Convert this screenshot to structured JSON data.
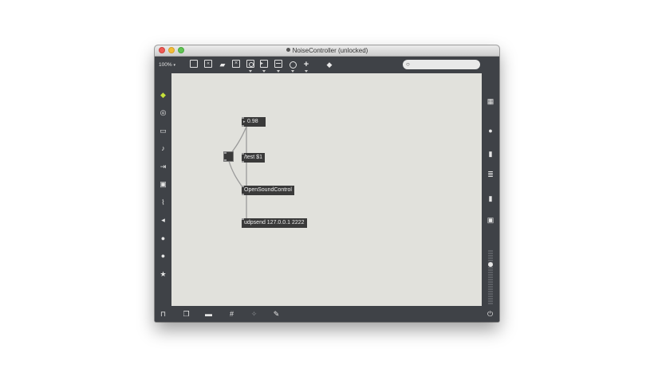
{
  "window": {
    "title": "NoiseController (unlocked)",
    "traffic_lights": [
      "close",
      "minimize",
      "zoom"
    ]
  },
  "toolbar": {
    "zoom_level": "100%",
    "zoom_arrow": "▾",
    "tools": [
      {
        "name": "presentation-view-icon"
      },
      {
        "name": "message-box-icon"
      },
      {
        "name": "comment-icon"
      },
      {
        "name": "object-box-icon"
      },
      {
        "name": "bang-icon"
      },
      {
        "name": "toggle-icon"
      },
      {
        "name": "number-box-icon"
      },
      {
        "name": "dial-icon"
      },
      {
        "name": "add-object-icon"
      },
      {
        "name": "paint-bucket-icon"
      }
    ],
    "search": {
      "placeholder": "",
      "icon": "magnifier-icon"
    }
  },
  "left_sidebar": {
    "icons": [
      "cube-icon",
      "target-icon",
      "slider-icon",
      "music-note-icon",
      "playback-icon",
      "image-icon",
      "paperclip-icon",
      "plug-icon",
      "vizzie-icon",
      "beap-icon",
      "star-icon"
    ]
  },
  "right_sidebar": {
    "icons": [
      "keyboard-grid-icon",
      "info-icon",
      "book-icon",
      "list-icon",
      "reference-icon",
      "camera-icon",
      "level-meter-icon"
    ]
  },
  "patch": {
    "objects": [
      {
        "id": "number",
        "text": "0.98"
      },
      {
        "id": "message",
        "text": "/test $1"
      },
      {
        "id": "osc",
        "text": "OpenSoundControl"
      },
      {
        "id": "udpsend",
        "text": "udpsend 127.0.0.1 2222"
      }
    ]
  },
  "bottom_bar": {
    "icons": [
      "lock-icon",
      "windows-icon",
      "presentation-icon",
      "grid-icon",
      "magic-wand-icon",
      "wrench-icon",
      "power-icon"
    ]
  },
  "colors": {
    "frame": "#3f4247",
    "canvas": "#e1e1dc",
    "object": "#3a3a3a",
    "patchcord": "#9a9a9a",
    "highlight": "#c6e23a"
  }
}
